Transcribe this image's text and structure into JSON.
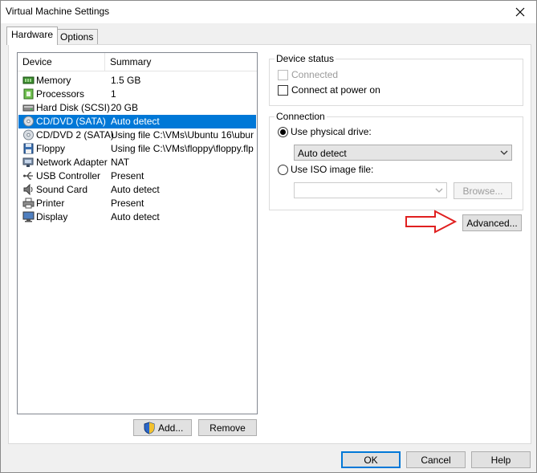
{
  "window": {
    "title": "Virtual Machine Settings"
  },
  "tabs": [
    {
      "label": "Hardware"
    },
    {
      "label": "Options"
    }
  ],
  "device_list": {
    "headers": {
      "device": "Device",
      "summary": "Summary"
    },
    "rows": [
      {
        "device": "Memory",
        "summary": "1.5 GB",
        "icon": "memory-icon"
      },
      {
        "device": "Processors",
        "summary": "1",
        "icon": "processor-icon"
      },
      {
        "device": "Hard Disk (SCSI)",
        "summary": "20 GB",
        "icon": "hard-disk-icon"
      },
      {
        "device": "CD/DVD (SATA)",
        "summary": "Auto detect",
        "icon": "cd-dvd-icon",
        "selected": true
      },
      {
        "device": "CD/DVD 2 (SATA)",
        "summary": "Using file C:\\VMs\\Ubuntu 16\\ubun...",
        "icon": "cd-dvd-icon"
      },
      {
        "device": "Floppy",
        "summary": "Using file C:\\VMs\\floppy\\floppy.flp",
        "icon": "floppy-icon"
      },
      {
        "device": "Network Adapter",
        "summary": "NAT",
        "icon": "network-icon"
      },
      {
        "device": "USB Controller",
        "summary": "Present",
        "icon": "usb-icon"
      },
      {
        "device": "Sound Card",
        "summary": "Auto detect",
        "icon": "sound-icon"
      },
      {
        "device": "Printer",
        "summary": "Present",
        "icon": "printer-icon"
      },
      {
        "device": "Display",
        "summary": "Auto detect",
        "icon": "display-icon"
      }
    ]
  },
  "list_buttons": {
    "add": "Add...",
    "remove": "Remove"
  },
  "device_status": {
    "label": "Device status",
    "connected": {
      "label": "Connected",
      "checked": false,
      "enabled": false
    },
    "connect_at_power_on": {
      "label": "Connect at power on",
      "checked": false
    }
  },
  "connection": {
    "label": "Connection",
    "physical_drive": {
      "label": "Use physical drive:",
      "selected": true,
      "value": "Auto detect"
    },
    "iso_image": {
      "label": "Use ISO image file:",
      "selected": false,
      "value": "",
      "browse_label": "Browse..."
    }
  },
  "advanced_button": "Advanced...",
  "footer": {
    "ok": "OK",
    "cancel": "Cancel",
    "help": "Help"
  },
  "colors": {
    "selection": "#0078d7",
    "annotation_arrow": "#e02020"
  }
}
